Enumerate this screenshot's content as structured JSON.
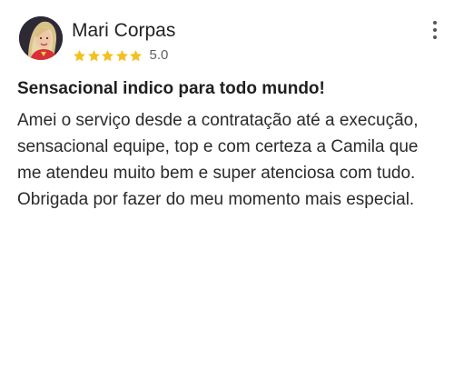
{
  "reviewer": {
    "name": "Mari Corpas",
    "avatar_icon": "user-avatar"
  },
  "rating": {
    "stars": 5,
    "max_stars": 5,
    "value_label": "5.0",
    "star_color": "#f4c020"
  },
  "menu": {
    "icon": "more-vertical-icon"
  },
  "review": {
    "title": "Sensacional indico para todo mundo!",
    "body": "Amei o serviço desde a contratação até a execução, sensacional equipe, top e com certeza a Camila que me atendeu muito bem e super atenciosa com tudo. Obrigada por fazer do meu momento mais especial."
  }
}
